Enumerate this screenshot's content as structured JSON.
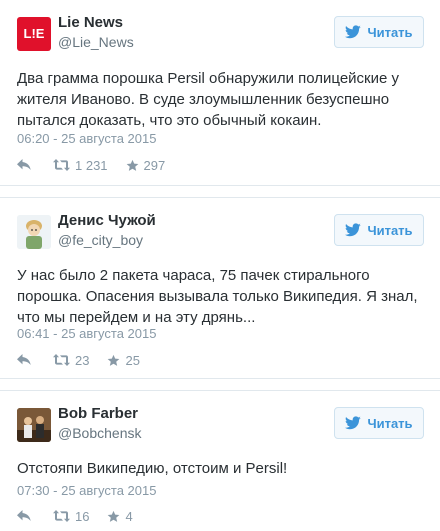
{
  "follow_label": "Читать",
  "tweets": [
    {
      "name": "Lie News",
      "handle": "@Lie_News",
      "avatar_text": "L!E",
      "text": "Два грамма порошка Persil обнаружили полицейские у жителя Иваново. В суде злоумышленник безуспешно пытался доказать, что это обычный кокаин.",
      "time": "06:20 - 25 августа 2015",
      "retweets": "1 231",
      "likes": "297"
    },
    {
      "name": "Денис Чужой",
      "handle": "@fe_city_boy",
      "text": "У нас было 2 пакета чараса, 75 пачек стирального порошка. Опасения вызывала только Википедия. Я знал, что мы перейдем и на эту дрянь...",
      "time": "06:41 - 25 августа 2015",
      "retweets": "23",
      "likes": "25"
    },
    {
      "name": "Bob Farber",
      "handle": "@Bobchensk",
      "text": "Отстояпи Википедию, отстоим и Persil!",
      "time": "07:30 - 25 августа 2015",
      "retweets": "16",
      "likes": "4"
    }
  ],
  "colors": {
    "brand": "#e0112b",
    "accent": "#3b94d9",
    "muted": "#8899a6"
  },
  "icons": [
    "reply-icon",
    "retweet-icon",
    "like-star-icon",
    "twitter-bird-icon"
  ]
}
